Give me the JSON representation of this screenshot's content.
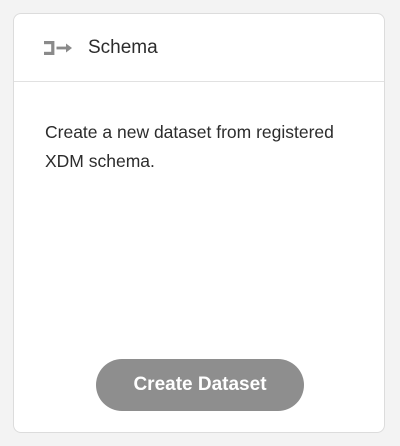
{
  "card": {
    "title": "Schema",
    "icon": "schema-icon",
    "description": "Create a new dataset from registered XDM schema.",
    "button_label": "Create Dataset"
  },
  "colors": {
    "button_background": "#8e8e8e",
    "button_text": "#ffffff",
    "icon": "#8a8a8a",
    "text": "#2c2c2c"
  }
}
